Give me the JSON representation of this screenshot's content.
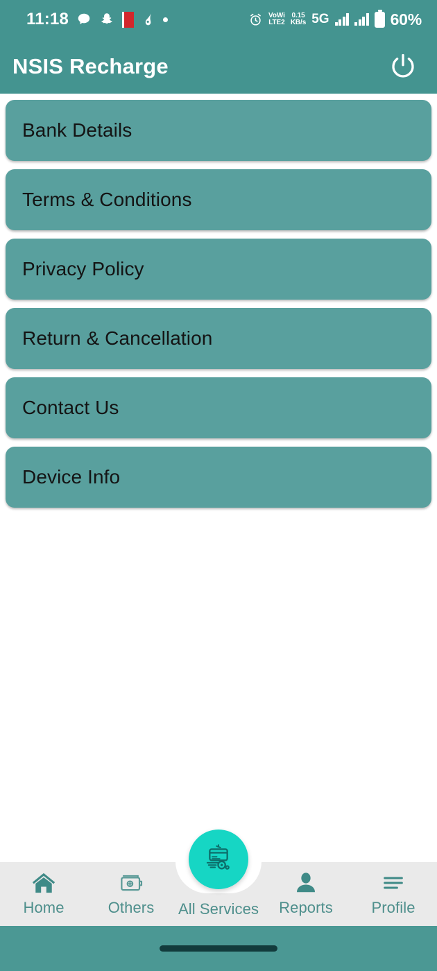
{
  "status_bar": {
    "time": "11:18",
    "left_icons": [
      "chat-bubble-icon",
      "snapchat-icon",
      "red-book-app-icon",
      "app-icon",
      "dot-icon"
    ],
    "volte_label": "VoWi",
    "lte_label": "LTE2",
    "data_rate_value": "0.15",
    "data_rate_unit": "KB/s",
    "network_type": "5G",
    "battery_percent": "60%",
    "right_icons": [
      "alarm-icon",
      "signal-bars-icon",
      "signal-bars-icon",
      "battery-icon"
    ]
  },
  "app_bar": {
    "title": "NSIS Recharge",
    "power_icon": "power-icon"
  },
  "menu": {
    "items": [
      {
        "label": "Bank Details"
      },
      {
        "label": "Terms & Conditions"
      },
      {
        "label": "Privacy Policy"
      },
      {
        "label": "Return & Cancellation"
      },
      {
        "label": "Contact Us"
      },
      {
        "label": "Device Info"
      }
    ]
  },
  "bottom_nav": {
    "items": [
      {
        "label": "Home",
        "icon": "home-icon"
      },
      {
        "label": "Others",
        "icon": "wallet-icon"
      },
      {
        "label": "All Services",
        "icon": "credit-card-recharge-icon"
      },
      {
        "label": "Reports",
        "icon": "person-icon"
      },
      {
        "label": "Profile",
        "icon": "hamburger-menu-icon"
      }
    ]
  },
  "colors": {
    "app_bar": "#449490",
    "card": "#59a09e",
    "fab": "#16d6c4",
    "nav_background": "#eaeaea",
    "nav_label": "#4e8f8c",
    "gesture_bar": "#4b9894"
  }
}
